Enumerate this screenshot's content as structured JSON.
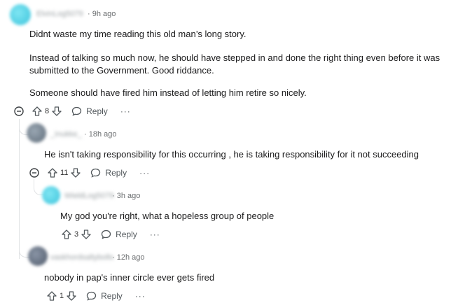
{
  "comments": [
    {
      "username": "ElvinLog5079",
      "time": "9h ago",
      "paragraphs": [
        "Didnt waste my time reading this old man’s long story.",
        "Instead of talking so much now, he should have stepped in and done the right thing even before it was",
        "submitted to the Government. Good riddance.",
        "Someone should have fired him instead of letting him retire so nicely."
      ],
      "votes": "8",
      "reply_label": "Reply",
      "more_label": "···"
    },
    {
      "username": "_Inukke_",
      "time": "18h ago",
      "body": "He isn't taking responsibility for this occurring , he is taking responsibility for it not succeeding",
      "votes": "11",
      "reply_label": "Reply",
      "more_label": "···"
    },
    {
      "username": "WieldLog5079",
      "time": "3h ago",
      "body": "My god you're right, what a hopeless group of people",
      "votes": "3",
      "reply_label": "Reply",
      "more_label": "···"
    },
    {
      "username": "vaskhordsaltybolls",
      "time": "12h ago",
      "body": "nobody in pap's inner circle ever gets fired",
      "votes": "1",
      "reply_label": "Reply",
      "more_label": "···"
    }
  ],
  "colors": {
    "accent_avatar": "#4fd1e8",
    "thread_line": "#e1e3e5"
  }
}
